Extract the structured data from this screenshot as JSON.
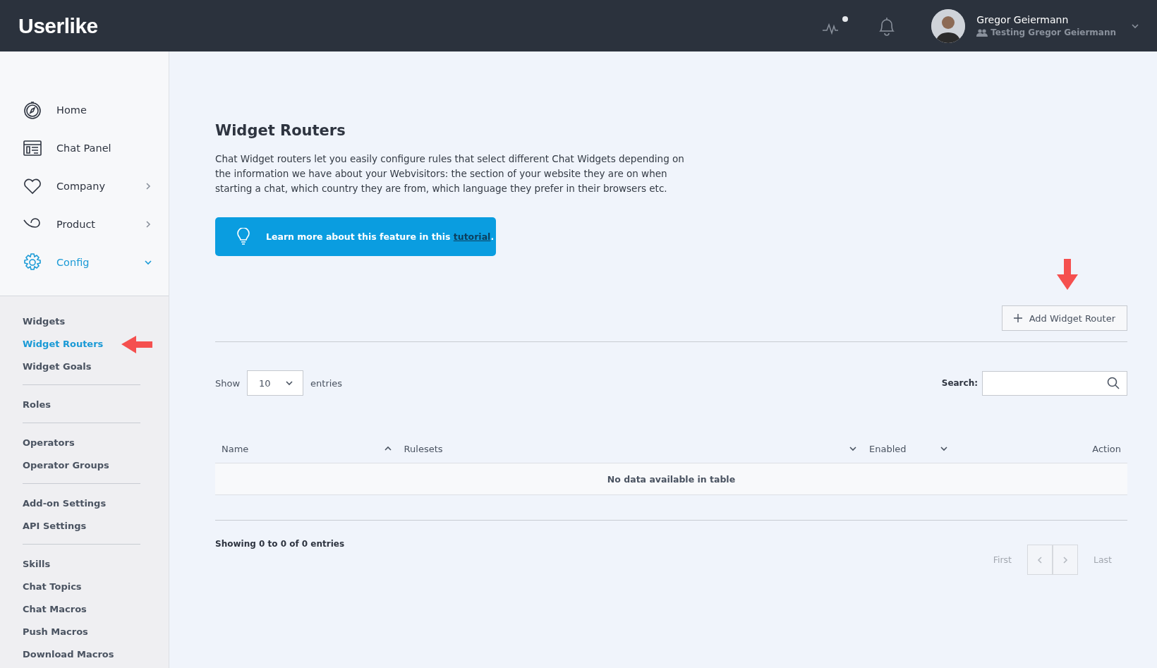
{
  "header": {
    "logo": "Userlike",
    "user": {
      "name": "Gregor Geiermann",
      "account": "Testing Gregor Geiermann"
    }
  },
  "sidebar": {
    "items": [
      {
        "label": "Home",
        "selected": false
      },
      {
        "label": "Chat Panel",
        "selected": false
      },
      {
        "label": "Company",
        "selected": false,
        "expanded": false
      },
      {
        "label": "Product",
        "selected": false,
        "expanded": false
      },
      {
        "label": "Config",
        "selected": true,
        "expanded": true
      }
    ],
    "submenu": [
      [
        {
          "label": "Widgets",
          "selected": false
        },
        {
          "label": "Widget Routers",
          "selected": true
        },
        {
          "label": "Widget Goals",
          "selected": false
        }
      ],
      [
        {
          "label": "Roles",
          "selected": false
        }
      ],
      [
        {
          "label": "Operators",
          "selected": false
        },
        {
          "label": "Operator Groups",
          "selected": false
        }
      ],
      [
        {
          "label": "Add-on Settings",
          "selected": false
        },
        {
          "label": "API Settings",
          "selected": false
        }
      ],
      [
        {
          "label": "Skills",
          "selected": false
        },
        {
          "label": "Chat Topics",
          "selected": false
        },
        {
          "label": "Chat Macros",
          "selected": false
        },
        {
          "label": "Push Macros",
          "selected": false
        },
        {
          "label": "Download Macros",
          "selected": false
        }
      ]
    ]
  },
  "page": {
    "title": "Widget Routers",
    "description": "Chat Widget routers let you easily configure rules that select different Chat Widgets depending on the information we have about your Webvisitors: the section of your website they are on when starting a chat, which country they are from, which language they prefer in their browsers etc.",
    "tip": {
      "text": "Learn more about this feature in this",
      "link": "tutorial",
      "end": "."
    },
    "add_button": "Add Widget Router"
  },
  "table": {
    "show_label": "Show",
    "page_size": "10",
    "entries_label": "entries",
    "search_label": "Search:",
    "columns": [
      {
        "label": "Name",
        "sorted": true
      },
      {
        "label": "Rulesets",
        "sorted": false
      },
      {
        "label": "Enabled",
        "sorted": false
      },
      {
        "label": "Action"
      }
    ],
    "empty": "No data available in table",
    "info": "Showing 0 to 0 of 0 entries",
    "pagination": {
      "first": "First",
      "last": "Last",
      "prev_disabled": true,
      "next_disabled": true
    }
  }
}
